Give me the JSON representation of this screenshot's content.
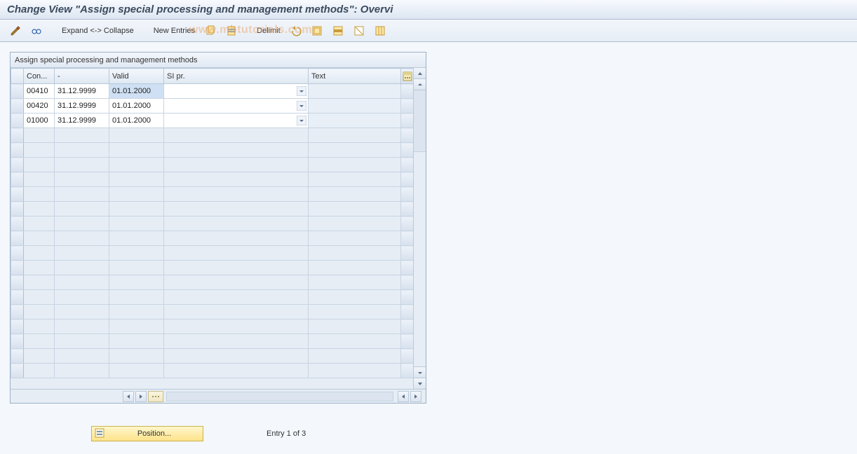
{
  "title": "Change View \"Assign special processing and management methods\": Overvi",
  "toolbar": {
    "expand_collapse": "Expand <-> Collapse",
    "new_entries": "New Entries",
    "delimit": "Delimit"
  },
  "panel": {
    "title": "Assign special processing and management methods"
  },
  "columns": {
    "con": "Con...",
    "dash": "-",
    "valid": "Valid",
    "si_pr": "SI pr.",
    "text": "Text"
  },
  "rows": [
    {
      "con": "00410",
      "dash": "31.12.9999",
      "valid": "01.01.2000",
      "si_pr": "",
      "text": "",
      "valid_selected": true
    },
    {
      "con": "00420",
      "dash": "31.12.9999",
      "valid": "01.01.2000",
      "si_pr": "",
      "text": "",
      "valid_selected": false
    },
    {
      "con": "01000",
      "dash": "31.12.9999",
      "valid": "01.01.2000",
      "si_pr": "",
      "text": "",
      "valid_selected": false
    }
  ],
  "empty_row_count": 17,
  "footer": {
    "position_label": "Position...",
    "entry_text": "Entry 1 of 3"
  }
}
